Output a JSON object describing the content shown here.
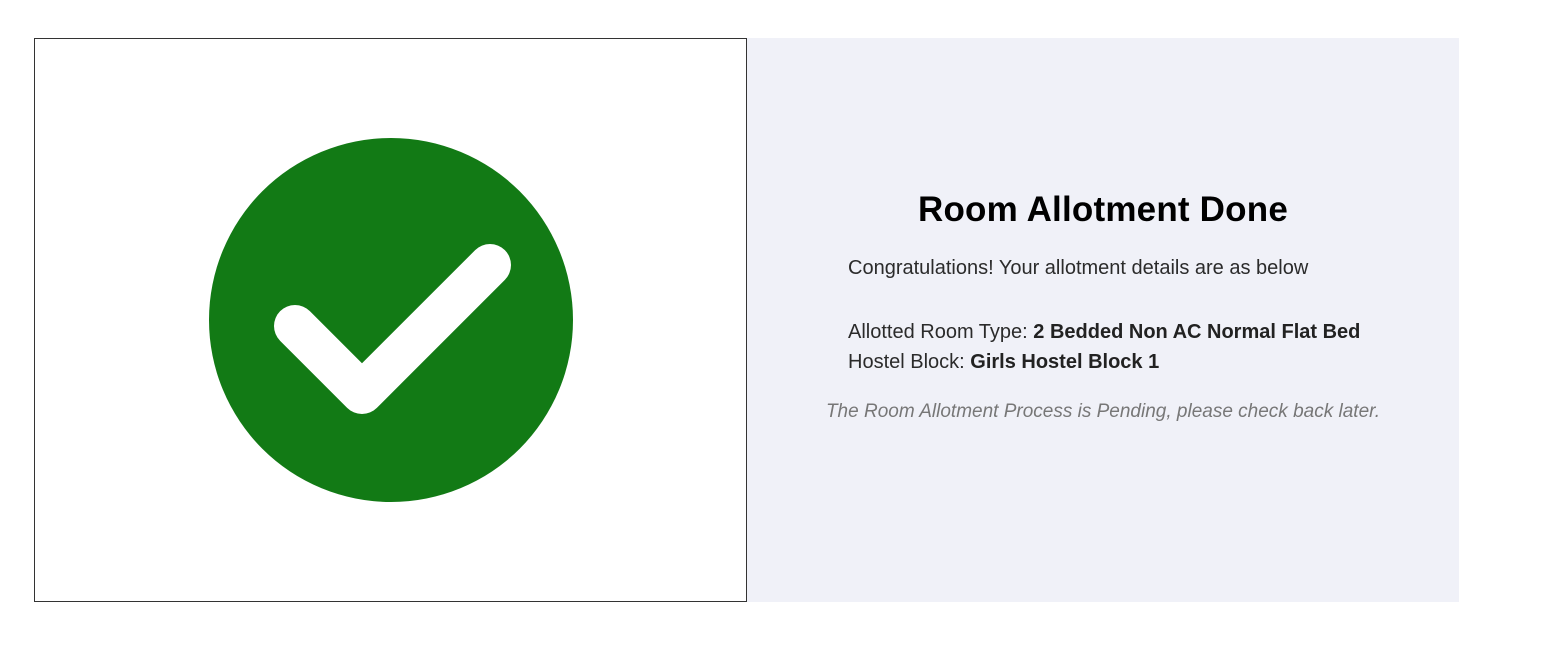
{
  "result": {
    "icon": "check-circle-icon",
    "icon_color": "#127a15"
  },
  "details": {
    "title": "Room Allotment Done",
    "congrats": "Congratulations! Your allotment details are as below",
    "room_type_label": "Allotted Room Type: ",
    "room_type_value": "2 Bedded Non AC Normal Flat Bed",
    "hostel_block_label": "Hostel Block: ",
    "hostel_block_value": "Girls Hostel Block 1",
    "pending_note": "The Room Allotment Process is Pending, please check back later.",
    "panel_color": "#f0f1f8"
  }
}
